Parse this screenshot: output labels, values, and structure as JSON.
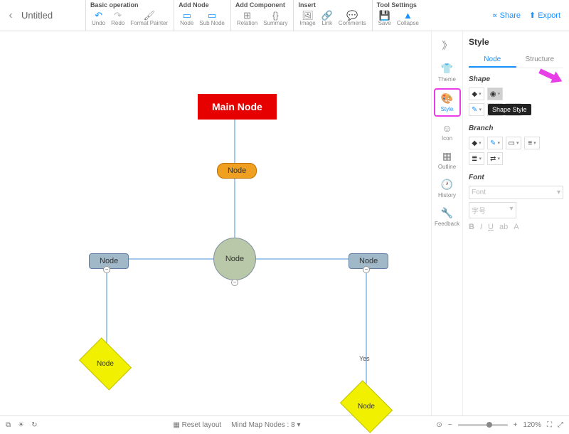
{
  "title": "Untitled",
  "toolbar": {
    "groups": [
      {
        "title": "Basic operation",
        "items": [
          {
            "ic": "↶",
            "lb": "Undo",
            "c": "#1890ff"
          },
          {
            "ic": "↷",
            "lb": "Redo",
            "c": "#bbb"
          },
          {
            "ic": "🖌",
            "lb": "Format Painter",
            "c": "#888"
          }
        ]
      },
      {
        "title": "Add Node",
        "items": [
          {
            "ic": "▭",
            "lb": "Node",
            "c": "#1890ff"
          },
          {
            "ic": "▭",
            "lb": "Sub Node",
            "c": "#1890ff"
          }
        ]
      },
      {
        "title": "Add Component",
        "items": [
          {
            "ic": "⊞",
            "lb": "Relation",
            "c": "#888"
          },
          {
            "ic": "{}",
            "lb": "Summary",
            "c": "#888"
          }
        ]
      },
      {
        "title": "Insert",
        "items": [
          {
            "ic": "🖼",
            "lb": "Image",
            "c": "#888"
          },
          {
            "ic": "🔗",
            "lb": "Link",
            "c": "#888"
          },
          {
            "ic": "💬",
            "lb": "Comments",
            "c": "#888"
          }
        ]
      },
      {
        "title": "Tool Settings",
        "items": [
          {
            "ic": "💾",
            "lb": "Save",
            "c": "#bbb"
          },
          {
            "ic": "▲",
            "lb": "Collapse",
            "c": "#1890ff"
          }
        ]
      }
    ],
    "share": "Share",
    "export": "Export"
  },
  "sidetabs": [
    {
      "ic": "》",
      "lb": ""
    },
    {
      "ic": "👕",
      "lb": "Theme"
    },
    {
      "ic": "🎨",
      "lb": "Style",
      "sel": true
    },
    {
      "ic": "☺",
      "lb": "Icon"
    },
    {
      "ic": "▦",
      "lb": "Outline"
    },
    {
      "ic": "🕐",
      "lb": "History"
    },
    {
      "ic": "🔧",
      "lb": "Feedback"
    }
  ],
  "panel": {
    "title": "Style",
    "tabs": [
      "Node",
      "Structure"
    ],
    "activeTab": 0,
    "shape": {
      "title": "Shape",
      "tooltip": "Shape Style"
    },
    "branch": {
      "title": "Branch"
    },
    "font": {
      "title": "Font",
      "ph1": "Font",
      "ph2": "字号",
      "fmts": [
        "B",
        "I",
        "U",
        "ab",
        "A"
      ]
    }
  },
  "canvas": {
    "main": "Main Node",
    "n1": "Node",
    "n2": "Node",
    "n3": "Node",
    "n4": "Node",
    "n5": "Node",
    "n6": "Node",
    "yes": "Yes"
  },
  "statusbar": {
    "reset": "Reset layout",
    "nodes_lbl": "Mind Map Nodes :",
    "nodes": "8",
    "zoom": "120%"
  }
}
